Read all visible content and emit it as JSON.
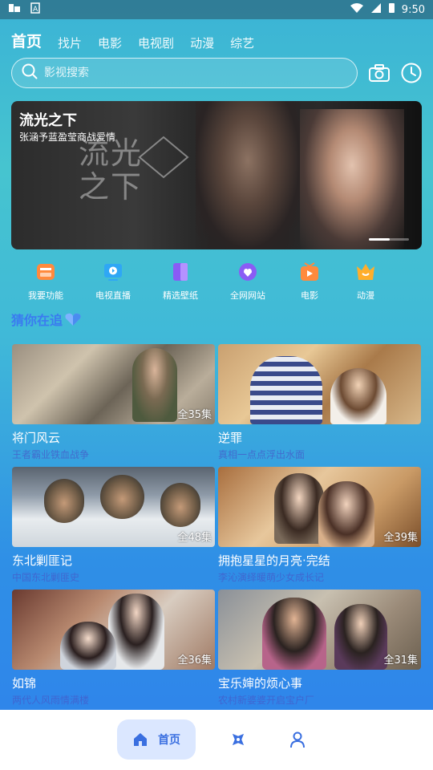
{
  "status_bar": {
    "time": "9:50"
  },
  "tabs": [
    "首页",
    "找片",
    "电影",
    "电视剧",
    "动漫",
    "综艺"
  ],
  "search": {
    "placeholder": "影视搜索"
  },
  "icons": {
    "search": "search-icon",
    "camera": "camera-icon",
    "history": "clock-icon"
  },
  "banner": {
    "title": "流光之下",
    "subtitle": "张涵予蓝盈莹商战爱情",
    "calligraphy_line1": "流光",
    "calligraphy_line2": "之下"
  },
  "quick_links": [
    {
      "label": "我要功能",
      "icon": "feature-icon",
      "color": "#ff8a3d"
    },
    {
      "label": "电视直播",
      "icon": "tv-live-icon",
      "color": "#2fa7f5"
    },
    {
      "label": "精选壁纸",
      "icon": "wallpaper-icon",
      "color": "#8a5cf5"
    },
    {
      "label": "全网网站",
      "icon": "web-icon",
      "color": "#8a5cf5"
    },
    {
      "label": "电影",
      "icon": "movie-icon",
      "color": "#ff8a3d"
    },
    {
      "label": "动漫",
      "icon": "anime-icon",
      "color": "#ffae2b"
    }
  ],
  "section": {
    "title": "猜你在追"
  },
  "shows": [
    {
      "title": "将门风云",
      "desc": "王者霸业铁血战争",
      "episodes": "全35集"
    },
    {
      "title": "逆罪",
      "desc": "真相一点点浮出水面",
      "episodes": ""
    },
    {
      "title": "东北剿匪记",
      "desc": "中国东北剿匪史",
      "episodes": "全48集"
    },
    {
      "title": "拥抱星星的月亮·完结",
      "desc": "李沁演绎暖萌少女成长记",
      "episodes": "全39集"
    },
    {
      "title": "如锦",
      "desc": "两代人风雨情满楼",
      "episodes": "全36集"
    },
    {
      "title": "宝乐婶的烦心事",
      "desc": "农村新婆婆开启宝户厂",
      "episodes": "全31集"
    }
  ],
  "bottom_nav": {
    "home_label": "首页"
  }
}
